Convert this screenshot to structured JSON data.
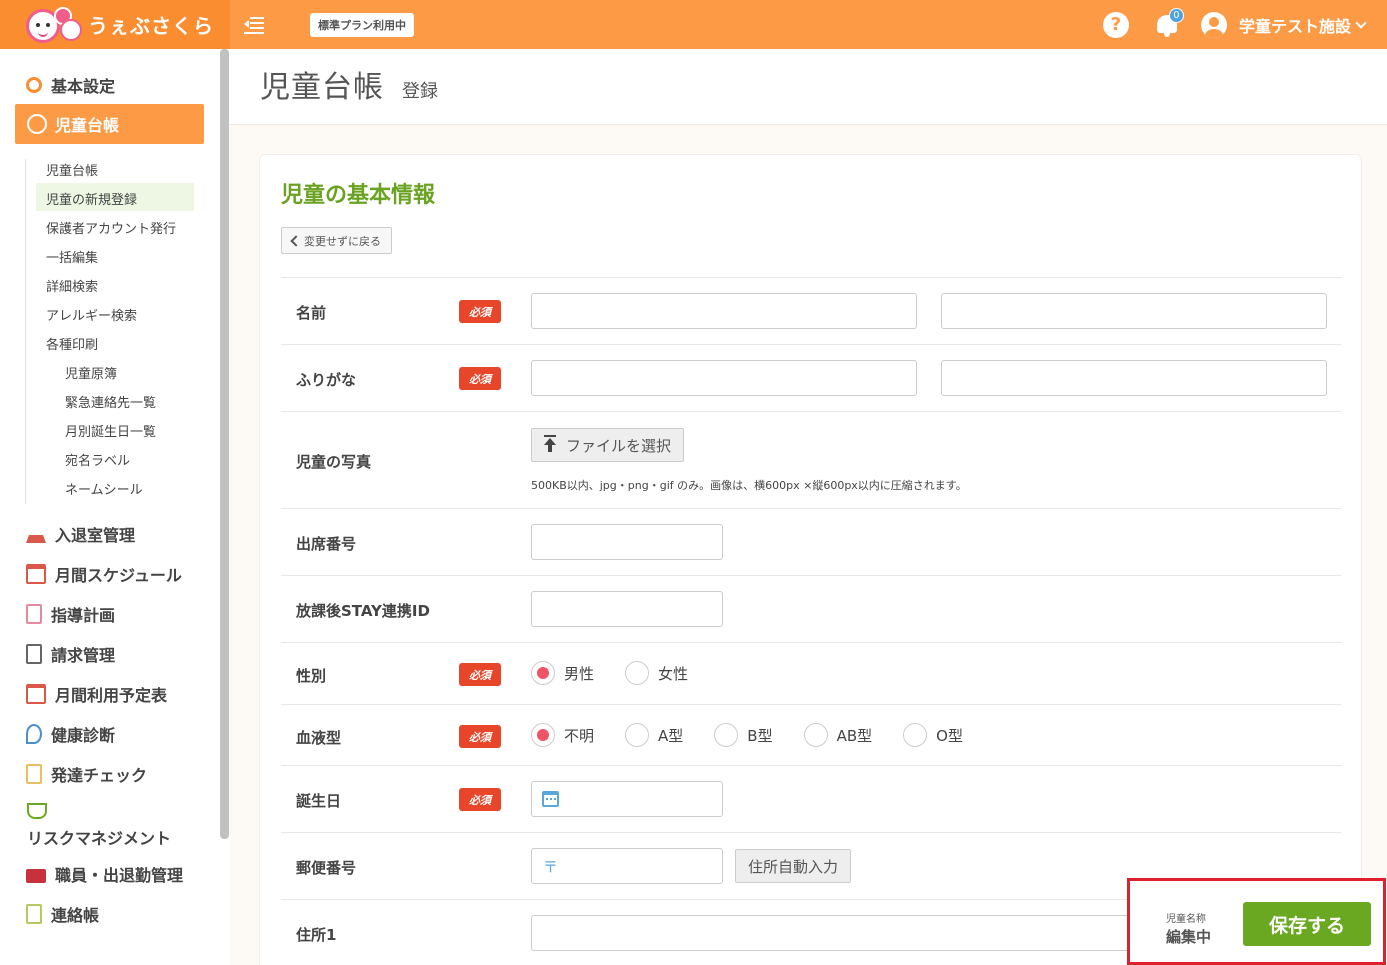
{
  "header": {
    "logo_text": "うぇぶさくら",
    "plan_badge": "標準プラン利用中",
    "help_label": "?",
    "notification_count": "0",
    "user_name": "学童テスト施設"
  },
  "sidebar": {
    "items": [
      {
        "label": "基本設定",
        "icon": "gears-icon"
      },
      {
        "label": "児童台帳",
        "icon": "child-face-icon"
      },
      {
        "label": "入退室管理",
        "icon": "school-icon"
      },
      {
        "label": "月間スケジュール",
        "icon": "calendar-28-icon"
      },
      {
        "label": "指導計画",
        "icon": "notebook-icon"
      },
      {
        "label": "請求管理",
        "icon": "calculator-icon"
      },
      {
        "label": "月間利用予定表",
        "icon": "calendar-clock-icon"
      },
      {
        "label": "健康診断",
        "icon": "stethoscope-icon"
      },
      {
        "label": "発達チェック",
        "icon": "checklist-icon"
      },
      {
        "label": "リスクマネジメント",
        "icon": "hands-heart-icon"
      },
      {
        "label": "職員・出退勤管理",
        "icon": "briefcase-icon"
      },
      {
        "label": "連絡帳",
        "icon": "book-icon"
      }
    ],
    "subitems": [
      "児童台帳",
      "児童の新規登録",
      "保護者アカウント発行",
      "一括編集",
      "詳細検索",
      "アレルギー検索",
      "各種印刷"
    ],
    "print_subitems": [
      "児童原簿",
      "緊急連絡先一覧",
      "月別誕生日一覧",
      "宛名ラベル",
      "ネームシール"
    ]
  },
  "page": {
    "title": "児童台帳",
    "subtitle": "登録"
  },
  "form": {
    "section_title": "児童の基本情報",
    "back_label": "変更せずに戻る",
    "required_label": "必須",
    "fields": {
      "name": "名前",
      "furigana": "ふりがな",
      "photo": "児童の写真",
      "attendance_no": "出席番号",
      "stay_id": "放課後STAY連携ID",
      "gender": "性別",
      "blood_type": "血液型",
      "birthday": "誕生日",
      "postal": "郵便番号",
      "address1": "住所1"
    },
    "file_button": "ファイルを選択",
    "photo_hint": "500KB以内、jpg・png・gif のみ。画像は、横600px ×縦600px以内に圧縮されます。",
    "gender_options": [
      "男性",
      "女性"
    ],
    "gender_selected": "男性",
    "blood_options": [
      "不明",
      "A型",
      "B型",
      "AB型",
      "O型"
    ],
    "blood_selected": "不明",
    "postal_mark": "〒",
    "address_button": "住所自動入力"
  },
  "save_panel": {
    "status_label": "児童名称",
    "status_value": "編集中",
    "save_button": "保存する"
  },
  "colors": {
    "header": "#fd9a45",
    "accent_green": "#6aa822",
    "required_red": "#e8462b",
    "highlight_border": "#e0202c"
  }
}
